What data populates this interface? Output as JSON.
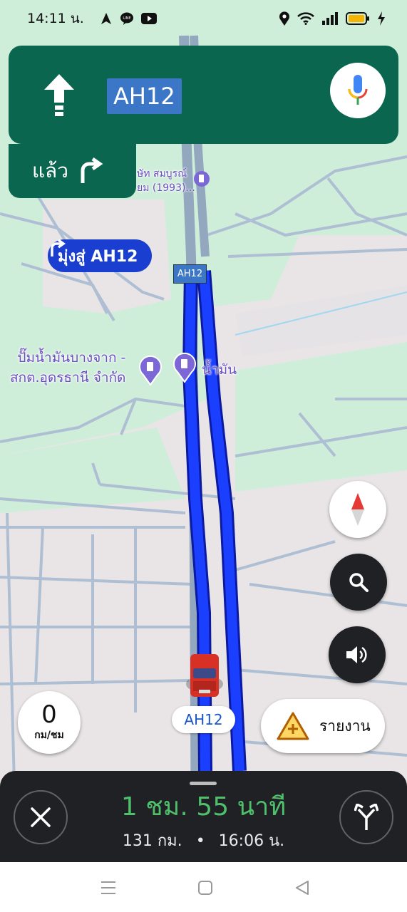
{
  "status_bar": {
    "time": "14:11 น.",
    "notification_icons": [
      "navigation-arrow-icon",
      "line-app-icon",
      "youtube-icon"
    ],
    "system_icons": [
      "location-icon",
      "wifi-icon",
      "signal-icon",
      "battery-icon",
      "charging-icon"
    ]
  },
  "direction": {
    "maneuver_icon": "straight-arrow-icon",
    "road": "AH12",
    "then_label": "แล้ว",
    "then_icon": "turn-right-icon"
  },
  "map": {
    "poi_company_line1": "ษัท สมบูรณ์",
    "poi_company_line2": "ยม (1993)...",
    "toward_label": "มุ่งสู่ AH12",
    "map_shield": "AH12",
    "poi_gas_line1": "ปั๊มน้ำมันบางจาก -",
    "poi_gas_line2": "สกต.อุดรธานี จำกัด",
    "poi_oil": "น้ำมัน",
    "current_road": "AH12"
  },
  "speed": {
    "value": "0",
    "unit": "กม/ชม"
  },
  "report": {
    "label": "รายงาน"
  },
  "trip": {
    "duration": "1 ชม. 55 นาที",
    "distance": "131 กม.",
    "separator": "•",
    "arrival": "16:06 น."
  },
  "colors": {
    "banner_green": "#0b6650",
    "route_blue": "#1a3fff",
    "eta_green": "#4fbf6b",
    "panel_dark": "#202124"
  }
}
